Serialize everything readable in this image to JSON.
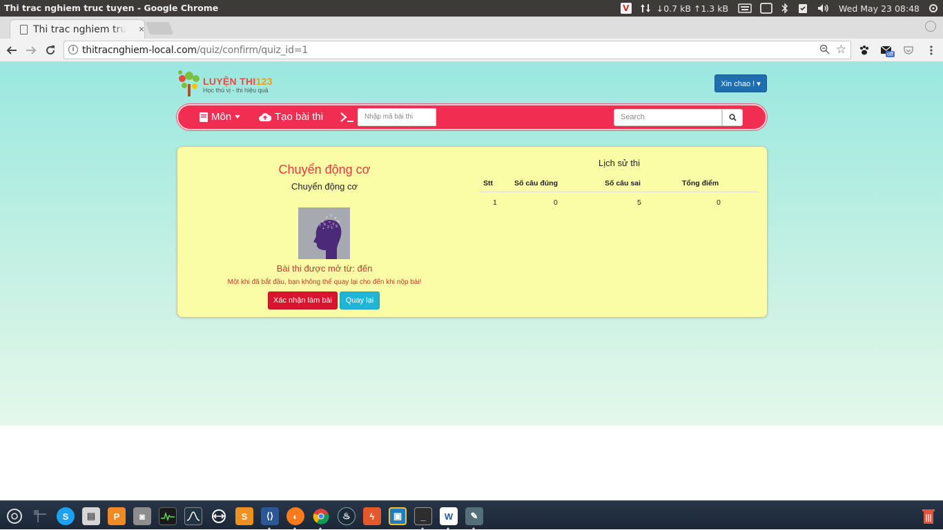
{
  "system": {
    "window_title": "Thi trac nghiem truc tuyen - Google Chrome",
    "net_down": "↓0.7 kB",
    "net_up": "↑1.3 kB",
    "datetime": "Wed May 23 08:48",
    "tray_v": "V"
  },
  "browser": {
    "tab_title": "Thi trac nghiem truc tuyen",
    "tab_close": "×",
    "url_host": "thitracnghiem-local.com",
    "url_path": "/quiz/confirm/quiz_id=1",
    "ext_badge": "off"
  },
  "site": {
    "logo_brand": "LUYỆN THI",
    "logo_num": "123",
    "logo_tagline": "Học thú vị - thi hiệu quả",
    "hello_label": "Xin chao ! ▾",
    "nav_subject": "Môn",
    "nav_create": "Tạo bài thi",
    "code_placeholder": "Nhập mã bài thi",
    "search_placeholder": "Search"
  },
  "quiz": {
    "title": "Chuyển động cơ",
    "subtitle": "Chuyển động cơ",
    "open_text": "Bài thi được mở từ: đến",
    "warning": "Một khi đã bắt đầu, bạn không thể quay lại cho đến khi nộp bài!",
    "confirm_label": "Xác nhận làm bài",
    "back_label": "Quay lại"
  },
  "history": {
    "title": "Lịch sử thi",
    "columns": [
      "Stt",
      "Số câu đúng",
      "Số câu sai",
      "Tổng điểm"
    ],
    "rows": [
      [
        "1",
        "0",
        "5",
        "0"
      ]
    ]
  },
  "colors": {
    "navbar": "#f12d52",
    "card": "#fbfca6",
    "confirm": "#d9142f",
    "back": "#1fb5d9",
    "hello": "#1f6fb0"
  },
  "taskbar_icons": [
    "ubuntu-icon",
    "workspace-icon",
    "skype-icon",
    "files-icon",
    "pdf-icon",
    "camera-icon",
    "system-monitor-icon",
    "scope-icon",
    "teamviewer-icon",
    "sublime-icon",
    "vscode-icon",
    "firefox-icon",
    "chrome-icon",
    "steam-icon",
    "lightning-icon",
    "virtualbox-icon",
    "terminal-icon",
    "word-icon",
    "notes-icon",
    "trash-icon"
  ]
}
